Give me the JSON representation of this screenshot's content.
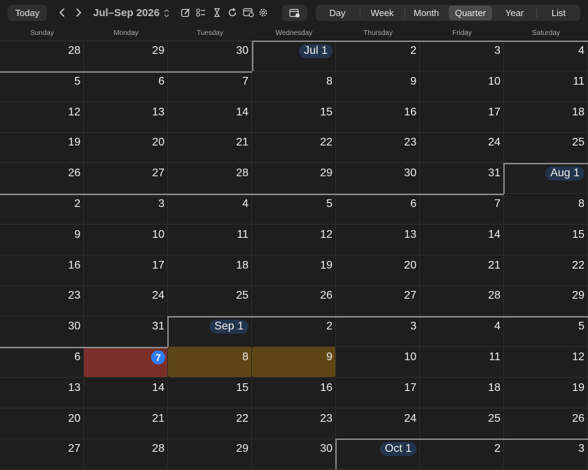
{
  "toolbar": {
    "today": "Today",
    "title": "Jul–Sep 2026",
    "views": [
      "Day",
      "Week",
      "Month",
      "Quarter",
      "Year",
      "List"
    ],
    "active_view": "Quarter"
  },
  "weekdays": [
    "Sunday",
    "Monday",
    "Tuesday",
    "Wednesday",
    "Thursday",
    "Friday",
    "Saturday"
  ],
  "weeks": [
    [
      "28",
      "29",
      "30",
      "Jul 1",
      "2",
      "3",
      "4"
    ],
    [
      "5",
      "6",
      "7",
      "8",
      "9",
      "10",
      "11"
    ],
    [
      "12",
      "13",
      "14",
      "15",
      "16",
      "17",
      "18"
    ],
    [
      "19",
      "20",
      "21",
      "22",
      "23",
      "24",
      "25"
    ],
    [
      "26",
      "27",
      "28",
      "29",
      "30",
      "31",
      "Aug 1"
    ],
    [
      "2",
      "3",
      "4",
      "5",
      "6",
      "7",
      "8"
    ],
    [
      "9",
      "10",
      "11",
      "12",
      "13",
      "14",
      "15"
    ],
    [
      "16",
      "17",
      "18",
      "19",
      "20",
      "21",
      "22"
    ],
    [
      "23",
      "24",
      "25",
      "26",
      "27",
      "28",
      "29"
    ],
    [
      "30",
      "31",
      "Sep 1",
      "2",
      "3",
      "4",
      "5"
    ],
    [
      "6",
      "7",
      "8",
      "9",
      "10",
      "11",
      "12"
    ],
    [
      "13",
      "14",
      "15",
      "16",
      "17",
      "18",
      "19"
    ],
    [
      "20",
      "21",
      "22",
      "23",
      "24",
      "25",
      "26"
    ],
    [
      "27",
      "28",
      "29",
      "30",
      "Oct 1",
      "2",
      "3"
    ]
  ],
  "today_date": "7",
  "highlight_colors": {
    "today": "#7a2e28",
    "selected": "#5e4614",
    "badge": "#2f7cf6",
    "month_pill": "#23344d"
  }
}
